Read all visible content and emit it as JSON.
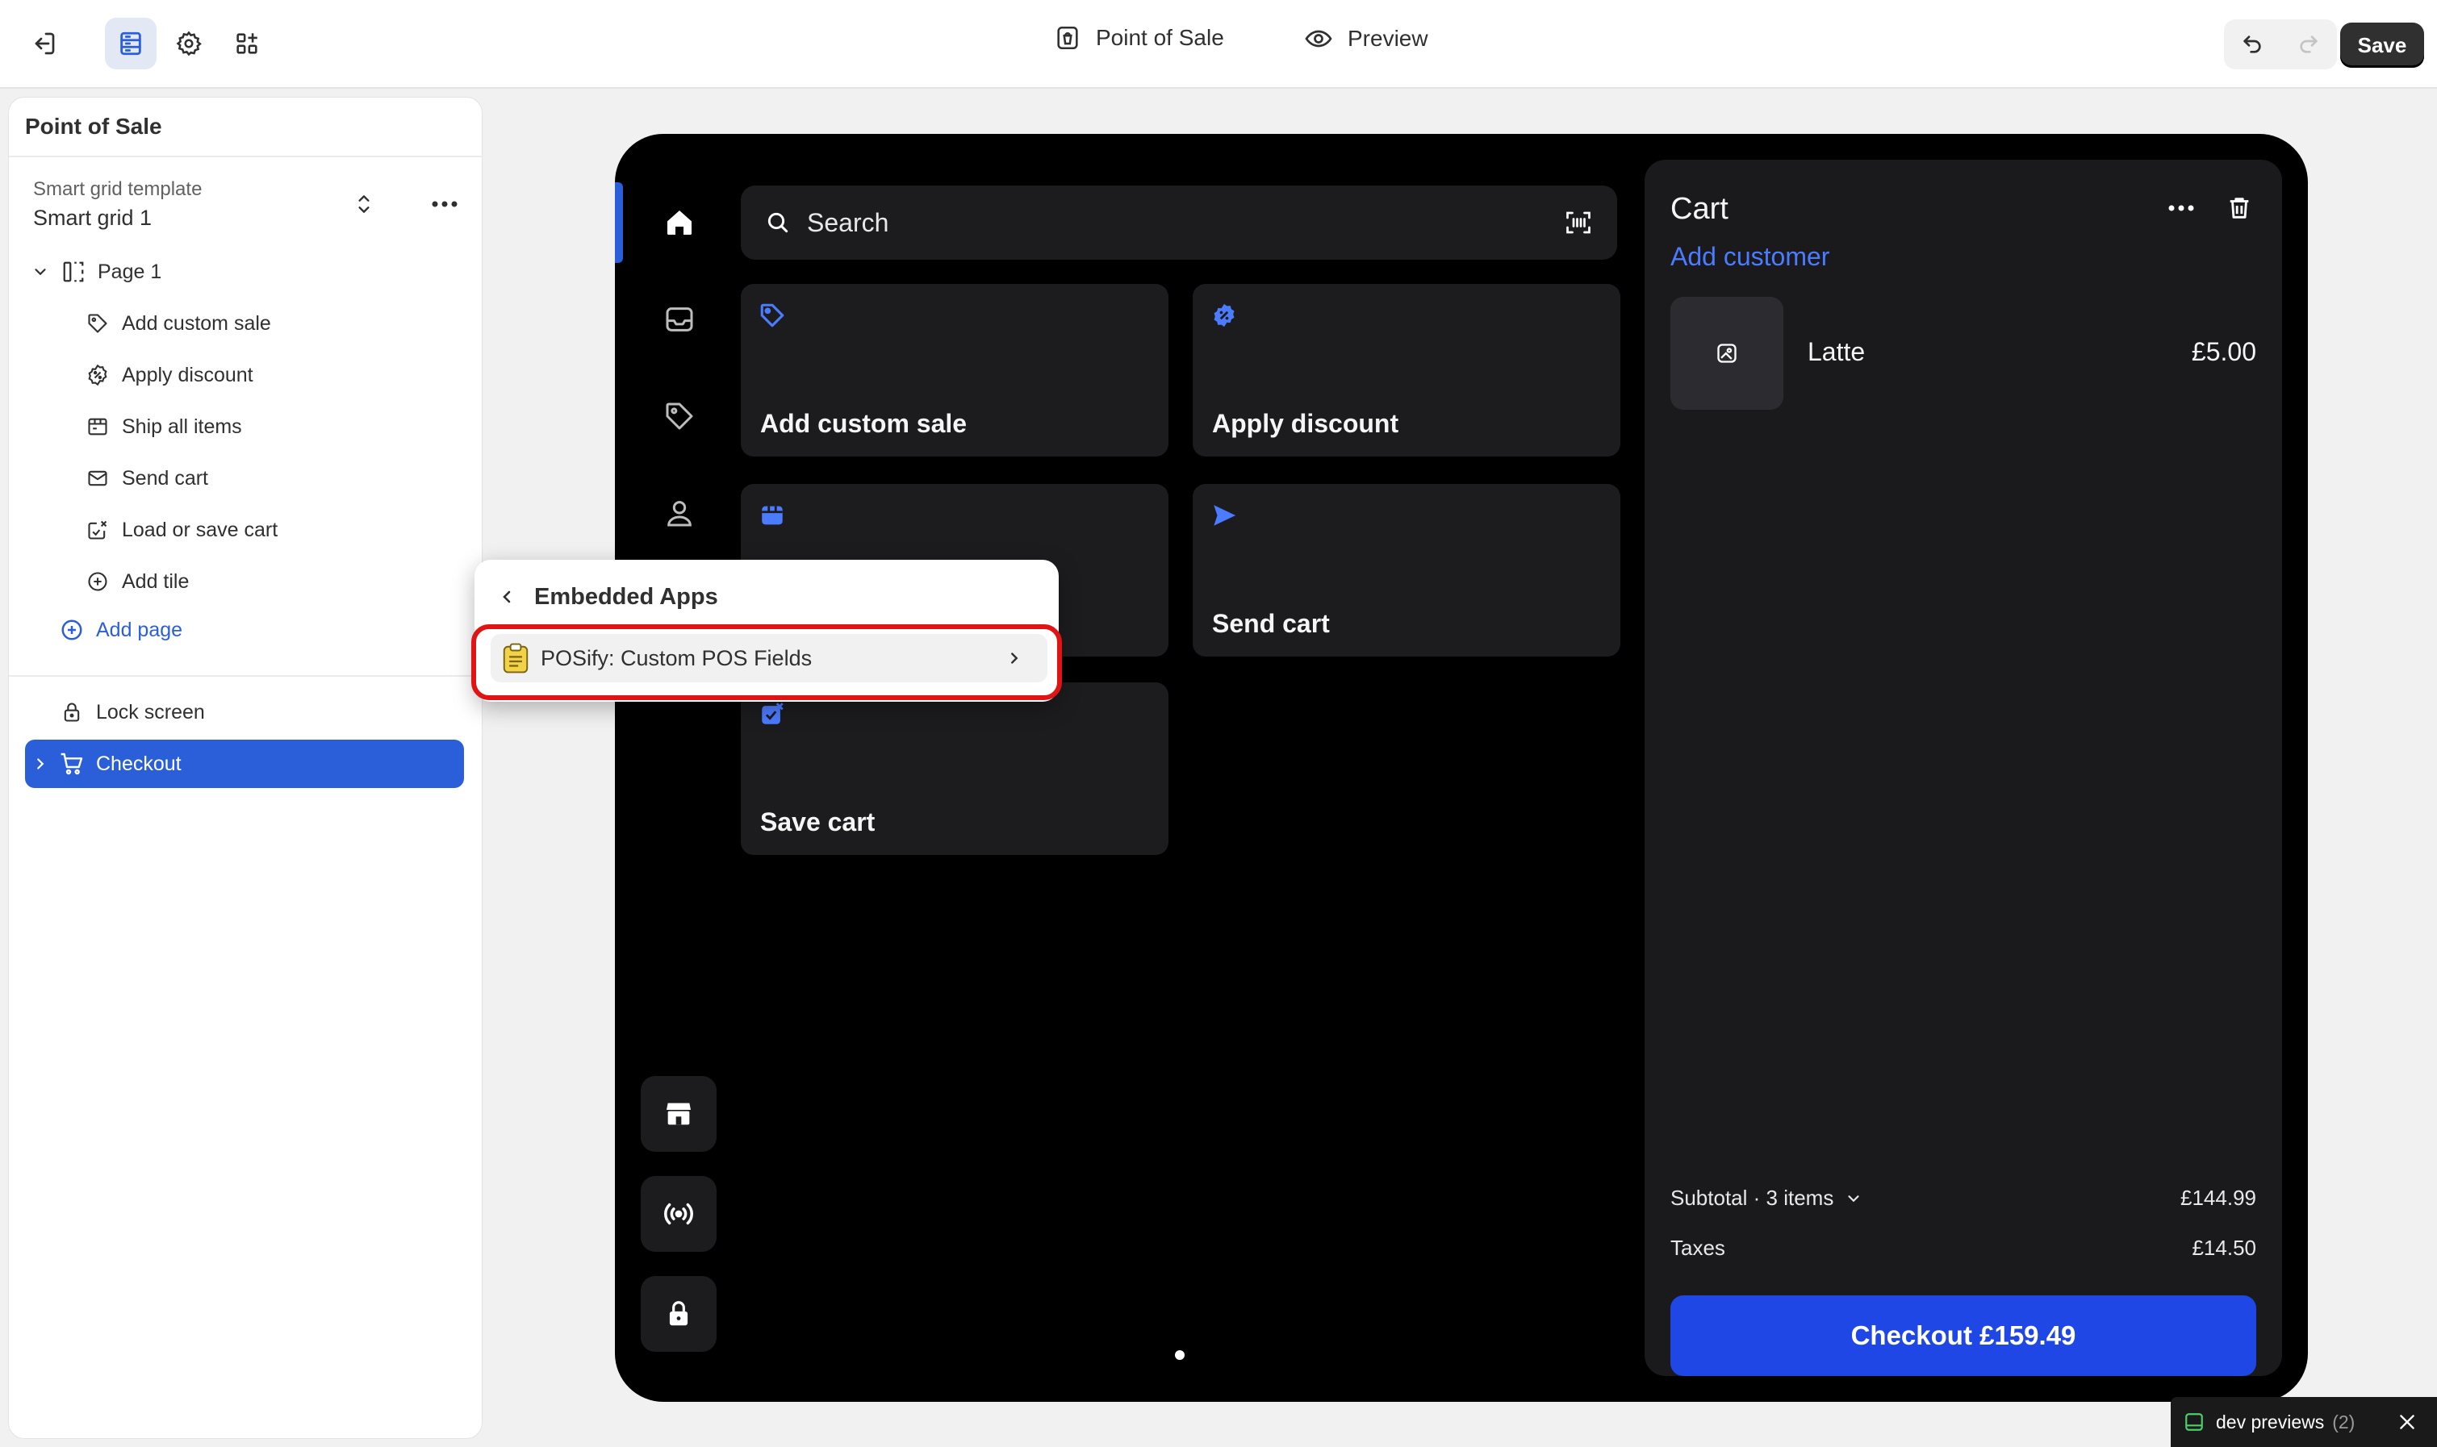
{
  "topbar": {
    "center_title": "Point of Sale",
    "preview_label": "Preview",
    "save_label": "Save"
  },
  "sidebar": {
    "title": "Point of Sale",
    "template_label": "Smart grid template",
    "template_value": "Smart grid 1",
    "page_label": "Page 1",
    "items": [
      {
        "label": "Add custom sale",
        "icon": "add-custom-sale-icon"
      },
      {
        "label": "Apply discount",
        "icon": "discount-icon"
      },
      {
        "label": "Ship all items",
        "icon": "ship-icon"
      },
      {
        "label": "Send cart",
        "icon": "send-cart-icon"
      },
      {
        "label": "Load or save cart",
        "icon": "load-save-cart-icon"
      },
      {
        "label": "Add tile",
        "icon": "plus-circle-icon"
      }
    ],
    "add_page_label": "Add page",
    "lock_screen_label": "Lock screen",
    "checkout_label": "Checkout"
  },
  "pos": {
    "search_placeholder": "Search",
    "tiles": [
      {
        "label": "Add custom sale"
      },
      {
        "label": "Apply discount"
      },
      {
        "label": ""
      },
      {
        "label": "Send cart"
      },
      {
        "label": "Save cart"
      }
    ],
    "cart": {
      "title": "Cart",
      "add_customer": "Add customer",
      "line_items": [
        {
          "name": "Latte",
          "price": "£5.00"
        }
      ],
      "subtotal_label": "Subtotal · 3 items",
      "subtotal_value": "£144.99",
      "taxes_label": "Taxes",
      "taxes_value": "£14.50",
      "checkout_label": "Checkout £159.49"
    }
  },
  "popover": {
    "title": "Embedded Apps",
    "item_label": "POSify: Custom POS Fields"
  },
  "dev_previews": {
    "label": "dev previews",
    "count": "(2)"
  },
  "colors": {
    "accent": "#2b5fd9",
    "checkout_button": "#1f47e6",
    "highlight": "#e01414",
    "pos_background": "#000000",
    "tile_background": "#1c1c1f"
  }
}
